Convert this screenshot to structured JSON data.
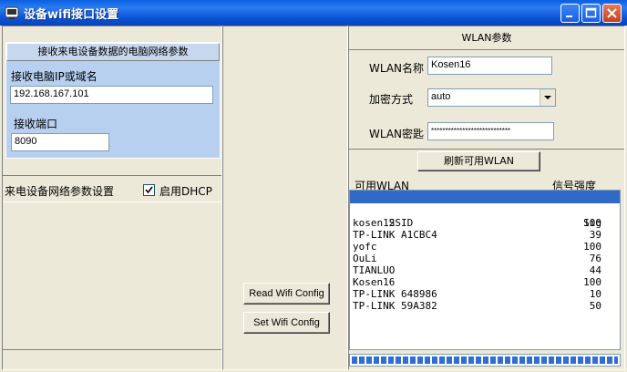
{
  "window": {
    "title": "设备wifi接口设置"
  },
  "left": {
    "group_header": "接收来电设备数据的电脑网络参数",
    "host_label": "接收电脑IP或域名",
    "host_value": "192.168.167.101",
    "port_label": "接收端口",
    "port_value": "8090",
    "device_label": "来电设备网络参数设置",
    "dhcp_label": "启用DHCP",
    "dhcp_checked": true
  },
  "middle": {
    "read_button": "Read Wifi Config",
    "set_button": "Set Wifi Config"
  },
  "right": {
    "header": "WLAN参数",
    "name_label": "WLAN名称",
    "name_value": "Kosen16",
    "enc_label": "加密方式",
    "enc_value": "auto",
    "key_label": "WLAN密匙",
    "key_value": "****************************",
    "refresh_button": "刷新可用WLAN",
    "list_label": "可用WLAN",
    "signal_label": "信号强度",
    "list_header": {
      "ssid": "SSID",
      "sig": "Sig"
    },
    "networks": [
      {
        "ssid": "kosen12",
        "sig": "100"
      },
      {
        "ssid": "TP-LINK A1CBC4",
        "sig": "39"
      },
      {
        "ssid": "yofc",
        "sig": "100"
      },
      {
        "ssid": "OuLi",
        "sig": "76"
      },
      {
        "ssid": "TIANLUO",
        "sig": "44"
      },
      {
        "ssid": "Kosen16",
        "sig": "100"
      },
      {
        "ssid": "TP-LINK 648986",
        "sig": "10"
      },
      {
        "ssid": "TP-LINK 59A382",
        "sig": "50"
      }
    ],
    "progress": 1.0
  },
  "colors": {
    "accent": "#0a5fe0",
    "group_bg": "#b8d0f0",
    "selection": "#3169c6"
  }
}
